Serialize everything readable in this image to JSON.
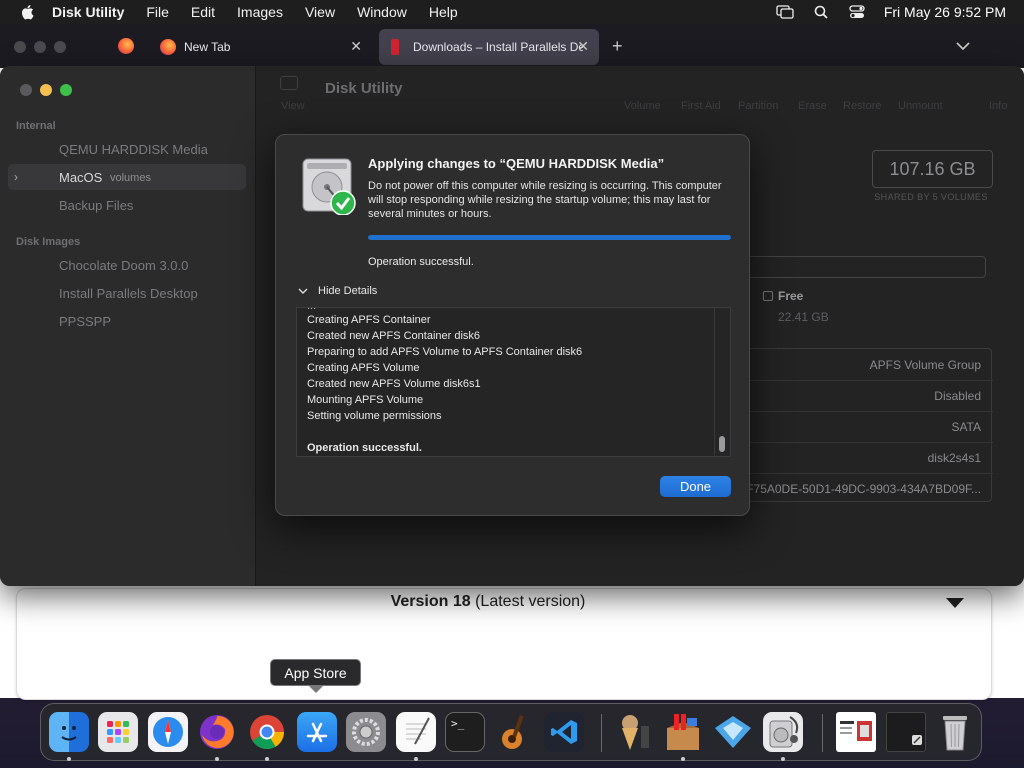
{
  "menubar": {
    "app_name": "Disk Utility",
    "items": [
      "File",
      "Edit",
      "Images",
      "View",
      "Window",
      "Help"
    ],
    "clock": "Fri May 26  9:52 PM"
  },
  "browser": {
    "tabs": [
      {
        "label": "New Tab"
      },
      {
        "label": "Downloads – Install Parallels De"
      }
    ],
    "version_label": "Version 18",
    "version_suffix": " (Latest version)"
  },
  "disk_utility": {
    "title": "Disk Utility",
    "sidebar": {
      "section_internal": "Internal",
      "items_internal": [
        {
          "label": "QEMU HARDDISK Media"
        },
        {
          "label": "MacOS",
          "sub": "volumes"
        },
        {
          "label": "Backup Files"
        }
      ],
      "section_images": "Disk Images",
      "items_images": [
        {
          "label": "Chocolate Doom 3.0.0"
        },
        {
          "label": "Install Parallels Desktop"
        },
        {
          "label": "PPSSPP"
        }
      ]
    },
    "toolbar": {
      "view": "View",
      "volume": "Volume",
      "first_aid": "First Aid",
      "partition": "Partition",
      "erase": "Erase",
      "restore": "Restore",
      "unmount": "Unmount",
      "info": "Info"
    },
    "capacity": "107.16 GB",
    "capacity_sub": "SHARED BY 5 VOLUMES",
    "free_label": "Free",
    "free_value": "22.41 GB",
    "info_rows": [
      "APFS Volume Group",
      "Disabled",
      "SATA",
      "disk2s4s1",
      "F75A0DE-50D1-49DC-9903-434A7BD09F..."
    ]
  },
  "dialog": {
    "title": "Applying changes to “QEMU HARDDISK Media”",
    "message": "Do not power off this computer while resizing is occurring. This computer will stop responding while resizing the startup volume; this may last for several minutes or hours.",
    "progress": 1.0,
    "status": "Operation successful.",
    "details_toggle": "Hide Details",
    "log": [
      "Creating APFS Container",
      "Created new APFS Container disk6",
      "Preparing to add APFS Volume to APFS Container disk6",
      "Creating APFS Volume",
      "Created new APFS Volume disk6s1",
      "Mounting APFS Volume",
      "Setting volume permissions",
      "",
      "Operation successful."
    ],
    "done_label": "Done"
  },
  "dock": {
    "tooltip": "App Store",
    "apps": [
      "finder-icon",
      "launchpad-icon",
      "safari-icon",
      "firefox-icon",
      "chrome-icon",
      "app-store-icon",
      "system-settings-icon",
      "textedit-icon",
      "terminal-icon",
      "garageband-icon",
      "vscode-icon",
      "chocolate-doom-icon",
      "parallels-icon",
      "ppsspp-icon",
      "disk-utility-icon",
      "document-icon",
      "window-icon",
      "trash-icon"
    ]
  }
}
